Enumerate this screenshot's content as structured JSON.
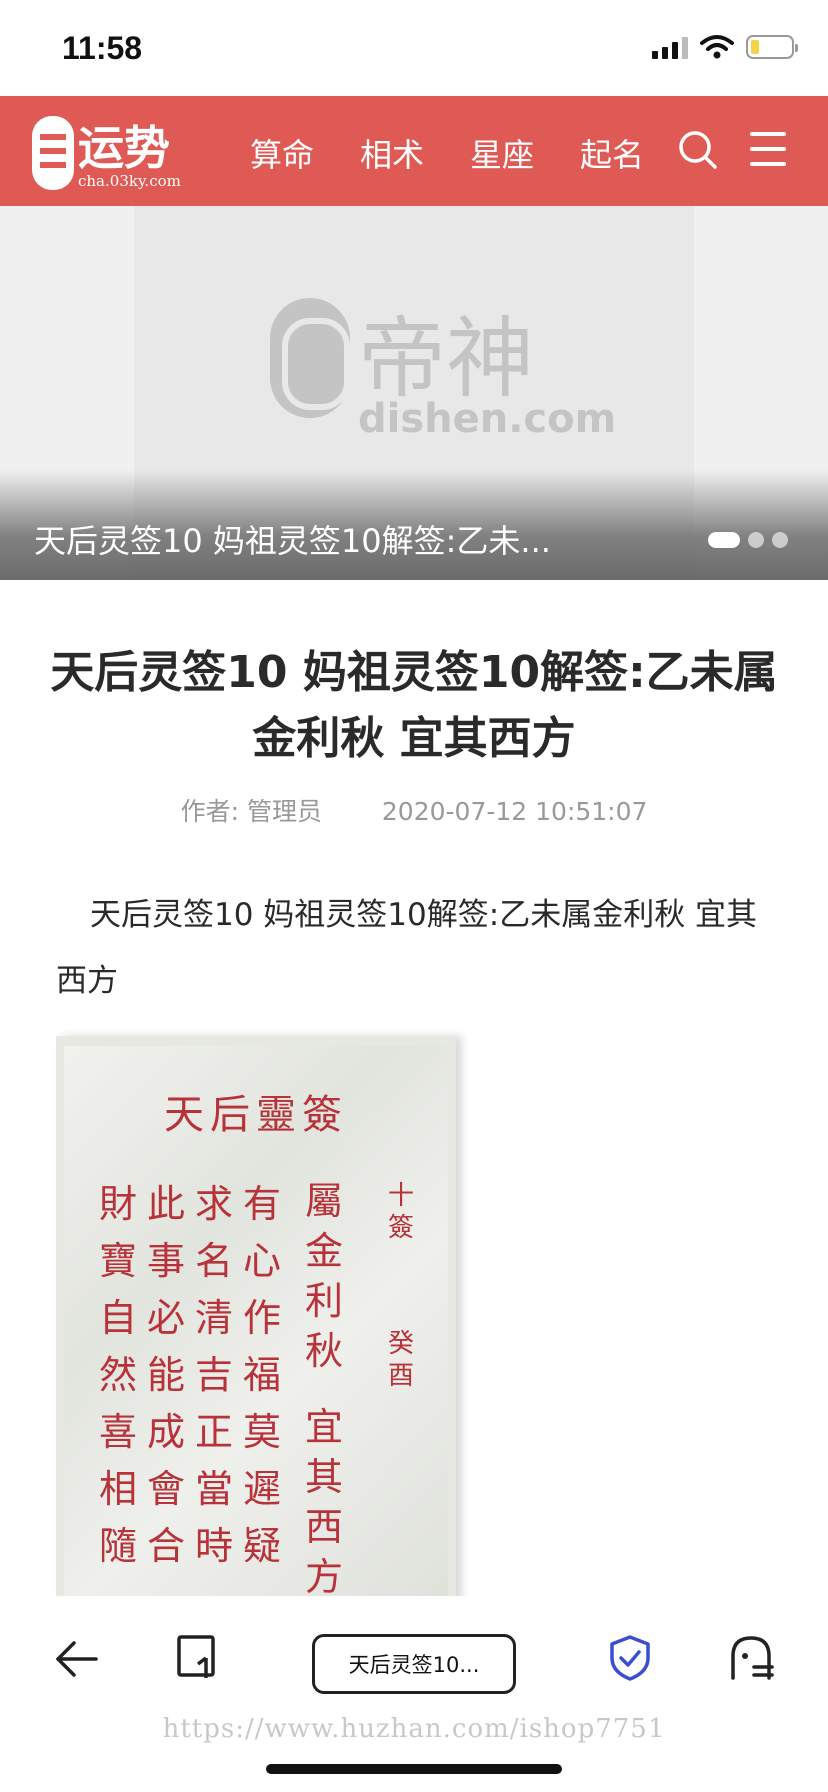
{
  "status": {
    "time": "11:58"
  },
  "nav": {
    "logo_text": "运势",
    "logo_sub": "cha.03ky.com",
    "items": [
      "算命",
      "相术",
      "星座",
      "起名"
    ]
  },
  "banner": {
    "watermark_text": "帝神",
    "watermark_sub": "dishen.com",
    "caption": "天后灵签10 妈祖灵签10解签:乙未...",
    "slide_count": 3,
    "active_slide": 1
  },
  "article": {
    "title": "天后灵签10 妈祖灵签10解签:乙未属金利秋 宜其西方",
    "author": "作者: 管理员",
    "date": "2020-07-12 10:51:07",
    "lead": "天后灵签10 妈祖灵签10解签:乙未属金利秋 宜其西方"
  },
  "lot": {
    "title": "天后靈簽",
    "col1": "財寶自然喜相隨",
    "col2": "此事必能成會合",
    "col3": "求名清吉正當時",
    "col4": "有心作福莫遲疑",
    "col5": "屬金利秋",
    "col5b": "宜其西方",
    "col6": "十簽",
    "col6b": "癸酉"
  },
  "toolbar": {
    "url_label": "天后灵签10..."
  },
  "footer": {
    "watermark": "https://www.huzhan.com/ishop7751"
  }
}
